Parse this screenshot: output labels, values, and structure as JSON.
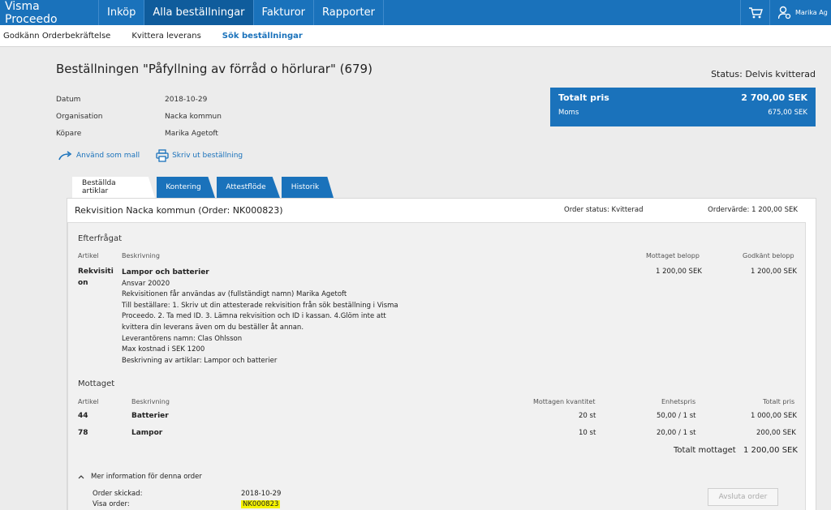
{
  "app": {
    "brand": "Visma Proceedo",
    "nav": [
      "Inköp",
      "Alla beställningar",
      "Fakturor",
      "Rapporter"
    ],
    "user": "Marika Ag"
  },
  "subnav": [
    "Godkänn Orderbekräftelse",
    "Kvittera leverans",
    "Sök beställningar"
  ],
  "header": {
    "title": "Beställningen \"Påfyllning av förråd o hörlurar\" (679)",
    "status": "Status: Delvis kvitterad"
  },
  "meta": [
    {
      "label": "Datum",
      "value": "2018-10-29"
    },
    {
      "label": "Organisation",
      "value": "Nacka kommun"
    },
    {
      "label": "Köpare",
      "value": "Marika Agetoft"
    }
  ],
  "price": {
    "total_label": "Totalt pris",
    "total_value": "2 700,00 SEK",
    "moms_label": "Moms",
    "moms_value": "675,00 SEK"
  },
  "actions": {
    "template": "Använd som mall",
    "print": "Skriv ut beställning"
  },
  "tabs": [
    "Beställda artiklar",
    "Kontering",
    "Attestflöde",
    "Historik"
  ],
  "requisition": {
    "title": "Rekvisition Nacka kommun (Order: NK000823)",
    "order_status": "Order status: Kvitterad",
    "order_value": "Ordervärde: 1 200,00 SEK"
  },
  "efterfragat": {
    "title": "Efterfrågat",
    "headers": {
      "article": "Artikel",
      "description": "Beskrivning",
      "received": "Mottaget belopp",
      "approved": "Godkänt belopp"
    },
    "article_line1": "Rekvisiti",
    "article_line2": "on",
    "desc_title": "Lampor och batterier",
    "desc_lines": [
      "Ansvar 20020",
      "Rekvisitionen får användas av (fullständigt namn) Marika Agetoft",
      "Till beställare: 1. Skriv ut din attesterade rekvisition från sök beställning i Visma",
      "Proceedo. 2. Ta med ID. 3. Lämna rekvisition och ID i kassan. 4.Glöm inte att",
      "kvittera din leverans även om du beställer åt annan.",
      "Leverantörens namn: Clas Ohlsson",
      "Max kostnad i SEK 1200",
      "Beskrivning av artiklar: Lampor och batterier"
    ],
    "received_amount": "1 200,00 SEK",
    "approved_amount": "1 200,00 SEK"
  },
  "mottaget": {
    "title": "Mottaget",
    "headers": {
      "article": "Artikel",
      "description": "Beskrivning",
      "qty": "Mottagen kvantitet",
      "unit_price": "Enhetspris",
      "total": "Totalt pris"
    },
    "rows": [
      {
        "article": "44",
        "description": "Batterier",
        "qty": "20 st",
        "unit_price": "50,00 / 1 st",
        "total": "1 000,00 SEK"
      },
      {
        "article": "78",
        "description": "Lampor",
        "qty": "10 st",
        "unit_price": "20,00 / 1 st",
        "total": "200,00 SEK"
      }
    ],
    "total_label": "Totalt mottaget",
    "total_value": "1 200,00 SEK"
  },
  "more_info": {
    "toggle": "Mer information för denna order",
    "sent_label": "Order skickad:",
    "sent_value": "2018-10-29",
    "view_label": "Visa order:",
    "view_value": "NK000823",
    "close_button": "Avsluta order"
  },
  "colors": {
    "brand": "#1a72bb",
    "highlight": "#f5f200"
  }
}
